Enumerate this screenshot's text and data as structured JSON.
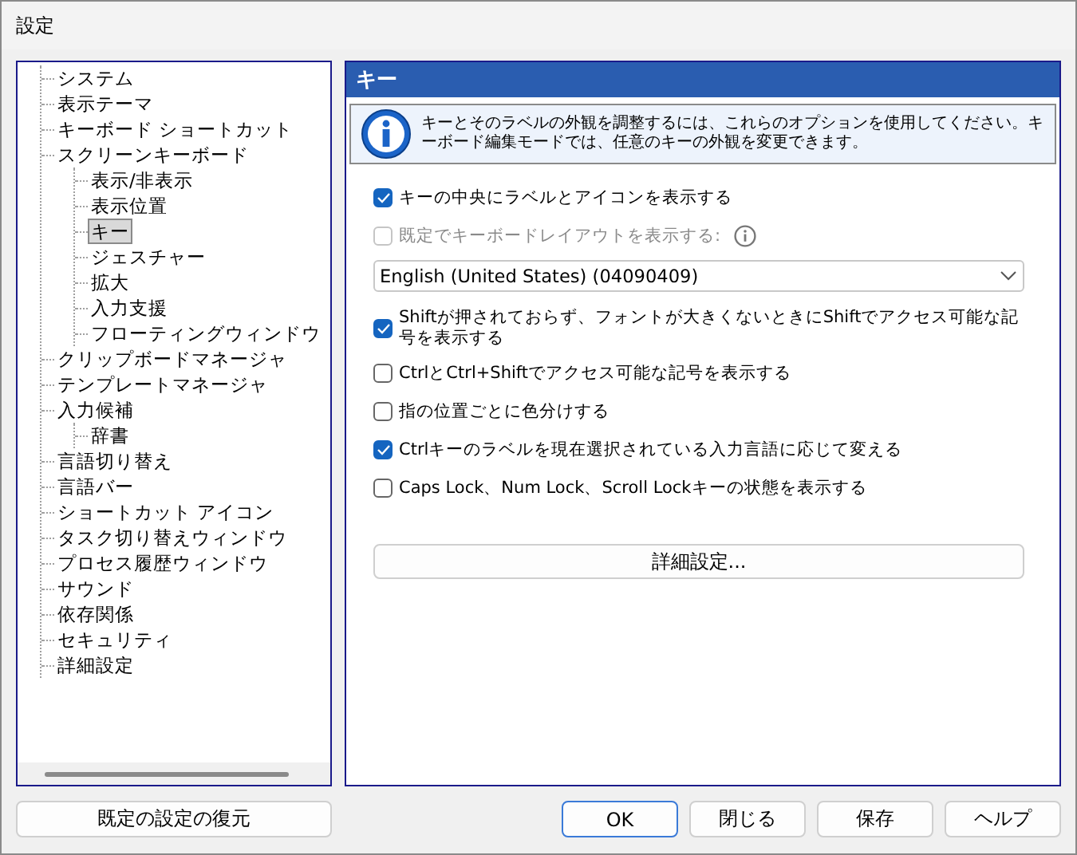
{
  "window": {
    "title": "設定"
  },
  "tree": [
    {
      "label": "システム",
      "selected": false
    },
    {
      "label": "表示テーマ",
      "selected": false
    },
    {
      "label": "キーボード ショートカット",
      "selected": false
    },
    {
      "label": "スクリーンキーボード",
      "selected": false,
      "children": [
        {
          "label": "表示/非表示",
          "selected": false
        },
        {
          "label": "表示位置",
          "selected": false
        },
        {
          "label": "キー",
          "selected": true
        },
        {
          "label": "ジェスチャー",
          "selected": false
        },
        {
          "label": "拡大",
          "selected": false
        },
        {
          "label": "入力支援",
          "selected": false
        },
        {
          "label": "フローティングウィンドウ",
          "selected": false
        }
      ]
    },
    {
      "label": "クリップボードマネージャ",
      "selected": false
    },
    {
      "label": "テンプレートマネージャ",
      "selected": false
    },
    {
      "label": "入力候補",
      "selected": false,
      "children": [
        {
          "label": "辞書",
          "selected": false
        }
      ]
    },
    {
      "label": "言語切り替え",
      "selected": false
    },
    {
      "label": "言語バー",
      "selected": false
    },
    {
      "label": "ショートカット アイコン",
      "selected": false
    },
    {
      "label": "タスク切り替えウィンドウ",
      "selected": false
    },
    {
      "label": "プロセス履歴ウィンドウ",
      "selected": false
    },
    {
      "label": "サウンド",
      "selected": false
    },
    {
      "label": "依存関係",
      "selected": false
    },
    {
      "label": "セキュリティ",
      "selected": false
    },
    {
      "label": "詳細設定",
      "selected": false
    }
  ],
  "panel": {
    "title": "キー",
    "info": "キーとそのラベルの外観を調整するには、これらのオプションを使用してください。キーボード編集モードでは、任意のキーの外観を変更できます。",
    "options": [
      {
        "kind": "checkbox",
        "label": "キーの中央にラベルとアイコンを表示する",
        "checked": true,
        "disabled": false,
        "info_button": false
      },
      {
        "kind": "checkbox",
        "label": "既定でキーボードレイアウトを表示する:",
        "checked": false,
        "disabled": true,
        "info_button": true
      },
      {
        "kind": "dropdown",
        "value": "English (United States) (04090409)"
      },
      {
        "kind": "checkbox",
        "label": "Shiftが押されておらず、フォントが大きくないときにShiftでアクセス可能な記号を表示する",
        "checked": true,
        "disabled": false,
        "info_button": false
      },
      {
        "kind": "checkbox",
        "label": "CtrlとCtrl+Shiftでアクセス可能な記号を表示する",
        "checked": false,
        "disabled": false,
        "info_button": false
      },
      {
        "kind": "checkbox",
        "label": "指の位置ごとに色分けする",
        "checked": false,
        "disabled": false,
        "info_button": false
      },
      {
        "kind": "checkbox",
        "label": "Ctrlキーのラベルを現在選択されている入力言語に応じて変える",
        "checked": true,
        "disabled": false,
        "info_button": false
      },
      {
        "kind": "checkbox",
        "label": "Caps Lock、Num Lock、Scroll Lockキーの状態を表示する",
        "checked": false,
        "disabled": false,
        "info_button": false
      }
    ],
    "advanced_button": "詳細設定..."
  },
  "buttons": {
    "restore": "既定の設定の復元",
    "actions": [
      {
        "label": "OK",
        "default": true
      },
      {
        "label": "閉じる",
        "default": false
      },
      {
        "label": "保存",
        "default": false
      },
      {
        "label": "ヘルプ",
        "default": false
      }
    ]
  }
}
